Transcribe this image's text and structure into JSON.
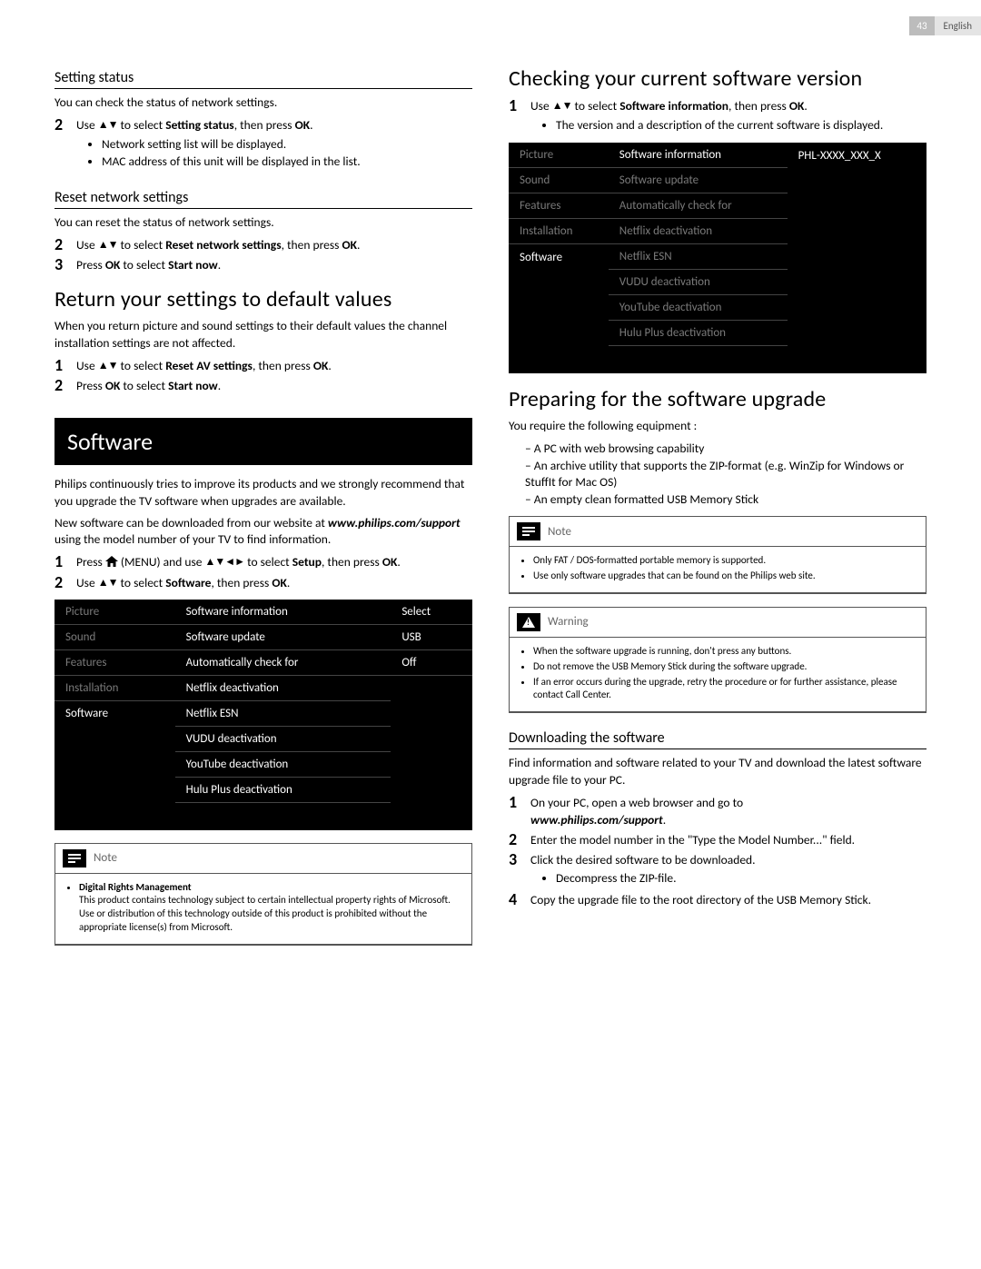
{
  "page_header": {
    "page_number": "43",
    "language": "English"
  },
  "left": {
    "setting_status": {
      "heading": "Setting status",
      "intro": "You can check the status of network settings.",
      "step2_pre": "Use ",
      "step2_mid": " to select ",
      "step2_target": "Setting status",
      "step2_post": ", then press ",
      "ok": "OK",
      "bullet1": "Network setting list will be displayed.",
      "bullet2": "MAC address of this unit will be displayed in the list."
    },
    "reset_network": {
      "heading": "Reset network settings",
      "intro": "You can reset the status of network settings.",
      "step2_pre": "Use ",
      "step2_mid": " to select ",
      "step2_target": "Reset network settings",
      "step2_post": ", then press ",
      "ok": "OK",
      "step3_pre": "Press ",
      "step3_mid": " to select ",
      "step3_target": "Start now"
    },
    "return_defaults": {
      "heading": "Return your settings to default values",
      "intro": "When you return picture and sound settings to their default values the channel installation settings are not affected.",
      "step1_pre": "Use ",
      "step1_mid": " to select ",
      "step1_target": "Reset AV settings",
      "step1_post": ", then press ",
      "ok": "OK",
      "step2_pre": "Press ",
      "step2_mid": " to select ",
      "step2_target": "Start now"
    },
    "software": {
      "banner": "Software",
      "para1": "Philips continuously tries to improve its products and we strongly recommend that you upgrade the TV software when upgrades are available.",
      "para2a": "New software can be downloaded from our website at ",
      "url": "www.philips.com/support",
      "para2b": " using the model number of your TV to find information.",
      "step1_a": "Press ",
      "step1_menu": " (MENU) and use ",
      "step1_b": " to select ",
      "step1_target": "Setup",
      "step1_post": ", then press ",
      "ok": "OK",
      "step2_pre": "Use ",
      "step2_mid": " to select ",
      "step2_target": "Software",
      "step2_post": ", then press "
    },
    "osd1": {
      "col1": [
        "Picture",
        "Sound",
        "Features",
        "Installation",
        "Software"
      ],
      "col2": [
        "Software information",
        "Software update",
        "Automatically check for",
        "Netflix deactivation",
        "Netflix ESN",
        "VUDU deactivation",
        "YouTube deactivation",
        "Hulu Plus deactivation"
      ],
      "col3": [
        "Select",
        "USB",
        "Off"
      ]
    },
    "note1": {
      "label": "Note",
      "bhead": "Digital Rights Management",
      "body": "This product contains technology subject to certain intellectual property rights of Microsoft. Use or distribution of this technology outside of this product is prohibited without the appropriate license(s) from Microsoft."
    }
  },
  "right": {
    "check_version": {
      "heading": "Checking your current software version",
      "step1_pre": "Use ",
      "step1_mid": " to select ",
      "step1_target": "Software information",
      "step1_post": ", then press ",
      "ok": "OK",
      "bullet1": "The version and a description of the current software is displayed."
    },
    "osd2": {
      "col1": [
        "Picture",
        "Sound",
        "Features",
        "Installation",
        "Software"
      ],
      "col2": [
        "Software information",
        "Software update",
        "Automatically check for",
        "Netflix deactivation",
        "Netflix ESN",
        "VUDU deactivation",
        "YouTube deactivation",
        "Hulu Plus deactivation"
      ],
      "col3": "PHL-XXXX_XXX_X"
    },
    "prepare": {
      "heading": "Preparing for the software upgrade",
      "intro": "You require the following equipment :",
      "d1": "A PC with web browsing capability",
      "d2": "An archive utility that supports the ZIP-format (e.g. WinZip for Windows or StuffIt for Mac OS)",
      "d3": "An empty clean formatted USB Memory Stick"
    },
    "note2": {
      "label": "Note",
      "b1": "Only FAT / DOS-formatted portable memory is supported.",
      "b2": "Use only software upgrades that can be found on the Philips web site."
    },
    "warn": {
      "label": "Warning",
      "b1": "When the software upgrade is running, don't press any buttons.",
      "b2": "Do not remove the USB Memory Stick during the software upgrade.",
      "b3": "If an error occurs during the upgrade, retry the procedure or for further assistance, please contact Call Center."
    },
    "download": {
      "heading": "Downloading the software",
      "intro": "Find information and software related to your TV and download the latest software upgrade file to your PC.",
      "s1": "On your PC, open a web browser and go to ",
      "url": "www.philips.com/support",
      "s2": "Enter the model number in the \"Type the Model Number...\" field.",
      "s3": "Click the desired software to be downloaded.",
      "s3b": "Decompress the ZIP-file.",
      "s4": "Copy the upgrade file to the root directory of the USB Memory Stick."
    },
    "period": "."
  }
}
